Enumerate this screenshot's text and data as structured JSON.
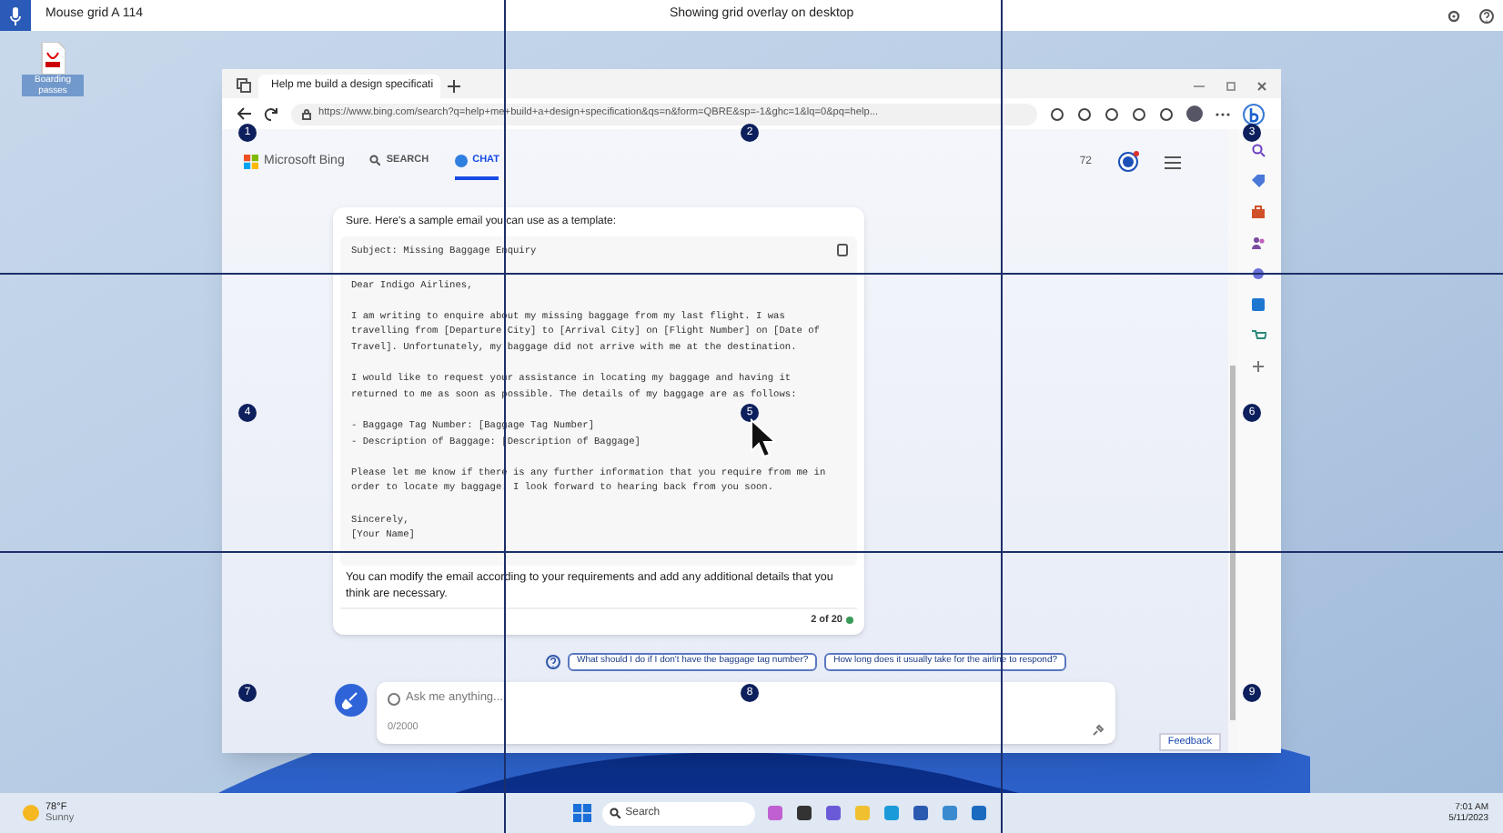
{
  "top_bar": {
    "app_title": "Mouse grid A 114",
    "status": "Showing grid overlay on desktop"
  },
  "desktop_icons": [
    {
      "label": "Boarding passes"
    }
  ],
  "browser": {
    "tab_title": "Help me build a design specificati",
    "url": "https://www.bing.com/search?q=help+me+build+a+design+specification&qs=n&form=QBRE&sp=-1&ghc=1&lq=0&pq=help...",
    "brand": "Microsoft Bing",
    "nav_tabs": [
      {
        "label": "SEARCH",
        "selected": false
      },
      {
        "label": "CHAT",
        "selected": true
      }
    ],
    "points": "72",
    "chat": {
      "intro": "Sure. Here's a sample email you can use as a template:",
      "email_paragraphs": [
        [
          "Subject: Missing Baggage Enquiry"
        ],
        [
          "Dear Indigo Airlines,"
        ],
        [
          "I am writing to enquire about my missing baggage from my last flight. I was",
          "travelling from [Departure City] to [Arrival City] on [Flight Number] on [Date of",
          "Travel]. Unfortunately, my baggage did not arrive with me at the destination."
        ],
        [
          "I would like to request your assistance in locating my baggage and having it",
          "returned to me as soon as possible. The details of my baggage are as follows:"
        ],
        [
          "- Baggage Tag Number: [Baggage Tag Number]",
          "- Description of Baggage: [Description of Baggage]"
        ],
        [
          "Please let me know if there is any further information that you require from me in",
          "order to locate my baggage. I look forward to hearing back from you soon."
        ],
        [
          "Sincerely,",
          "[Your Name]"
        ]
      ],
      "outro": "You can modify the email according to your requirements and add any additional details that you think are necessary.",
      "counter": "2 of 20",
      "suggestions": [
        "What should I do if I don't have the baggage tag number?",
        "How long does it usually take for the airline to respond?"
      ],
      "input_placeholder": "Ask me anything...",
      "char_count": "0/2000"
    },
    "feedback": "Feedback"
  },
  "grid_labels": [
    "1",
    "2",
    "3",
    "4",
    "5",
    "6",
    "7",
    "8",
    "9"
  ],
  "taskbar": {
    "temperature": "78°F",
    "condition": "Sunny",
    "search": "Search",
    "time": "7:01 AM",
    "date": "5/11/2023"
  }
}
